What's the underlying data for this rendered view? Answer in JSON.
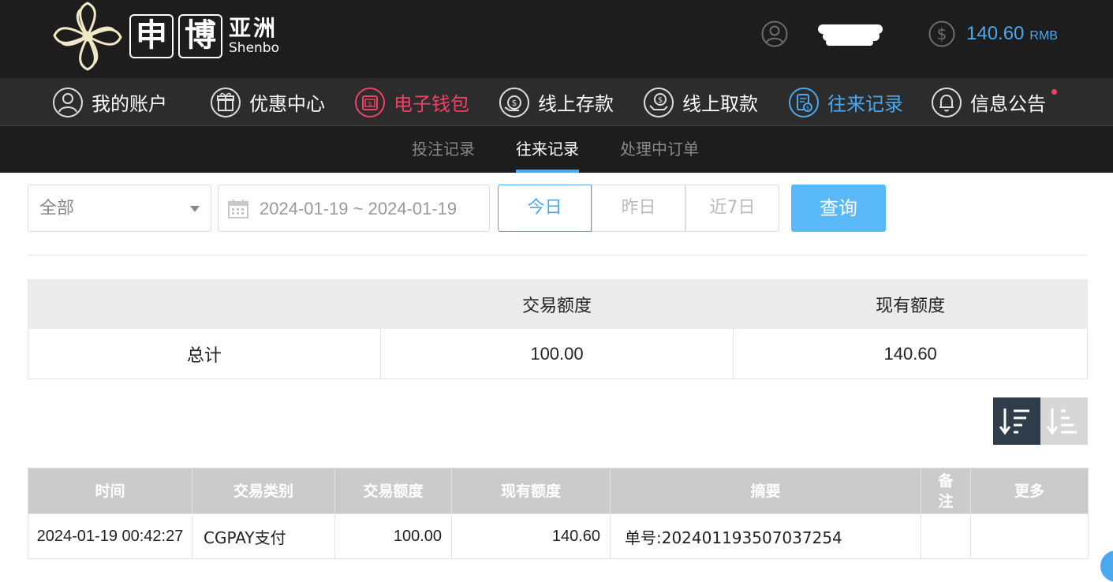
{
  "brand": {
    "logo_char1": "申",
    "logo_char2": "博",
    "logo_cn": "亚洲",
    "logo_en": "Shenbo"
  },
  "header": {
    "balance_amount": "140.60",
    "balance_unit": "RMB",
    "accent_color": "#4aa9ee"
  },
  "nav": {
    "items": [
      {
        "label": "我的账户",
        "icon": "user-icon"
      },
      {
        "label": "优惠中心",
        "icon": "gift-icon"
      },
      {
        "label": "电子钱包",
        "icon": "wallet-icon"
      },
      {
        "label": "线上存款",
        "icon": "deposit-icon"
      },
      {
        "label": "线上取款",
        "icon": "withdraw-icon"
      },
      {
        "label": "往来记录",
        "icon": "records-icon"
      },
      {
        "label": "信息公告",
        "icon": "bell-icon"
      }
    ]
  },
  "subnav": {
    "tabs": [
      "投注记录",
      "往来记录",
      "处理中订单"
    ],
    "active": "往来记录"
  },
  "filter": {
    "type_value": "全部",
    "date_range": "2024-01-19 ~ 2024-01-19",
    "ranges": [
      "今日",
      "昨日",
      "近7日"
    ],
    "active_range": "今日",
    "query_label": "查询"
  },
  "summary": {
    "headers": [
      "",
      "交易额度",
      "现有额度"
    ],
    "row_label": "总计",
    "transaction_total": "100.00",
    "current_balance": "140.60"
  },
  "detail": {
    "headers": [
      "时间",
      "交易类别",
      "交易额度",
      "现有额度",
      "摘要",
      "备注",
      "更多"
    ],
    "rows": [
      {
        "time": "2024-01-19 00:42:27",
        "type": "CGPAY支付",
        "amount": "100.00",
        "balance": "140.60",
        "summary": "单号:202401193507037254",
        "note": "",
        "more": ""
      }
    ]
  }
}
